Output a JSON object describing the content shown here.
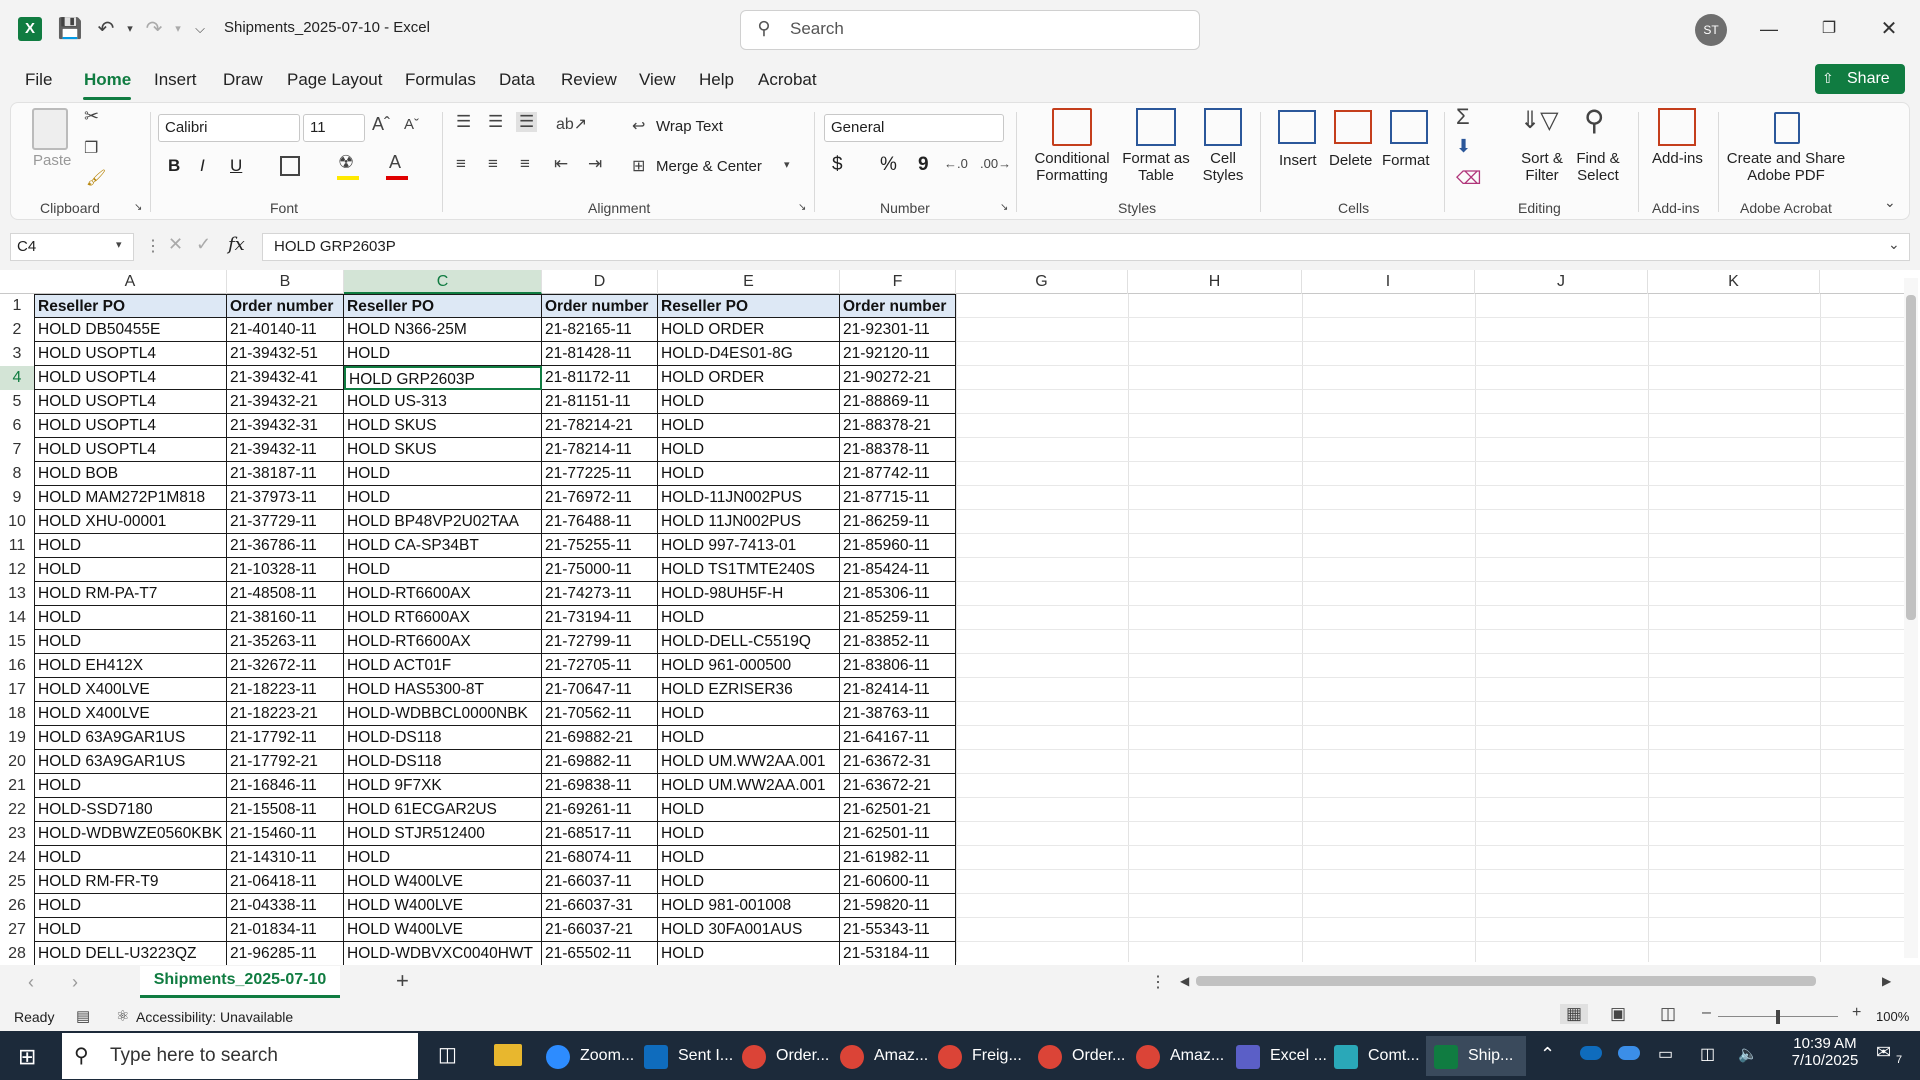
{
  "app": {
    "file_title": "Shipments_2025-07-10",
    "app_name": "Excel",
    "title_sep": "  -  ",
    "search_placeholder": "Search",
    "user_initials": "ST"
  },
  "menu": [
    "File",
    "Home",
    "Insert",
    "Draw",
    "Page Layout",
    "Formulas",
    "Data",
    "Review",
    "View",
    "Help",
    "Acrobat"
  ],
  "share_label": "Share",
  "ribbon": {
    "clipboard": {
      "paste": "Paste",
      "label": "Clipboard"
    },
    "font": {
      "name": "Calibri",
      "size": "11",
      "bold": "B",
      "italic": "I",
      "underline": "U",
      "label": "Font"
    },
    "alignment": {
      "wrap": "Wrap Text",
      "merge": "Merge & Center",
      "label": "Alignment"
    },
    "number": {
      "format": "General",
      "currency": "$",
      "percent": "%",
      "comma": "9",
      "label": "Number"
    },
    "styles": {
      "cond1": "Conditional",
      "cond2": "Formatting",
      "fmt1": "Format as",
      "fmt2": "Table",
      "cell1": "Cell",
      "cell2": "Styles",
      "label": "Styles"
    },
    "cells": {
      "insert": "Insert",
      "delete": "Delete",
      "format": "Format",
      "label": "Cells"
    },
    "editing": {
      "sort1": "Sort &",
      "sort2": "Filter",
      "find1": "Find &",
      "find2": "Select",
      "label": "Editing"
    },
    "addins": {
      "addins": "Add-ins",
      "label": "Add-ins"
    },
    "acrobat": {
      "create1": "Create and Share",
      "create2": "Adobe PDF",
      "label": "Adobe Acrobat"
    }
  },
  "formula_bar": {
    "name_box": "C4",
    "fx": "fx",
    "value": "HOLD GRP2603P"
  },
  "columns": [
    "A",
    "B",
    "C",
    "D",
    "E",
    "F",
    "G",
    "H",
    "I",
    "J",
    "K"
  ],
  "rows": [
    [
      "Reseller PO",
      "Order number",
      "Reseller PO",
      "Order number",
      "Reseller PO",
      "Order number"
    ],
    [
      "HOLD DB50455E",
      "21-40140-11",
      "HOLD N366-25M",
      "21-82165-11",
      "HOLD ORDER",
      "21-92301-11"
    ],
    [
      "HOLD USOPTL4",
      "21-39432-51",
      "HOLD",
      "21-81428-11",
      "HOLD-D4ES01-8G",
      "21-92120-11"
    ],
    [
      "HOLD USOPTL4",
      "21-39432-41",
      "HOLD GRP2603P",
      "21-81172-11",
      "HOLD ORDER",
      "21-90272-21"
    ],
    [
      "HOLD USOPTL4",
      "21-39432-21",
      "HOLD US-313",
      "21-81151-11",
      "HOLD",
      "21-88869-11"
    ],
    [
      "HOLD USOPTL4",
      "21-39432-31",
      "HOLD SKUS",
      "21-78214-21",
      "HOLD",
      "21-88378-21"
    ],
    [
      "HOLD USOPTL4",
      "21-39432-11",
      "HOLD SKUS",
      "21-78214-11",
      "HOLD",
      "21-88378-11"
    ],
    [
      "HOLD BOB",
      "21-38187-11",
      "HOLD",
      "21-77225-11",
      "HOLD",
      "21-87742-11"
    ],
    [
      "HOLD MAM272P1M818",
      "21-37973-11",
      "HOLD",
      "21-76972-11",
      "HOLD-11JN002PUS",
      "21-87715-11"
    ],
    [
      "HOLD XHU-00001",
      "21-37729-11",
      "HOLD BP48VP2U02TAA",
      "21-76488-11",
      "HOLD 11JN002PUS",
      "21-86259-11"
    ],
    [
      "HOLD",
      "21-36786-11",
      "HOLD CA-SP34BT",
      "21-75255-11",
      "HOLD 997-7413-01",
      "21-85960-11"
    ],
    [
      "HOLD",
      "21-10328-11",
      "HOLD",
      "21-75000-11",
      "HOLD TS1TMTE240S",
      "21-85424-11"
    ],
    [
      "HOLD RM-PA-T7",
      "21-48508-11",
      "HOLD-RT6600AX",
      "21-74273-11",
      "HOLD-98UH5F-H",
      "21-85306-11"
    ],
    [
      "HOLD",
      "21-38160-11",
      "HOLD RT6600AX",
      "21-73194-11",
      "HOLD",
      "21-85259-11"
    ],
    [
      "HOLD",
      "21-35263-11",
      "HOLD-RT6600AX",
      "21-72799-11",
      "HOLD-DELL-C5519Q",
      "21-83852-11"
    ],
    [
      "HOLD EH412X",
      "21-32672-11",
      "HOLD ACT01F",
      "21-72705-11",
      "HOLD 961-000500",
      "21-83806-11"
    ],
    [
      "HOLD X400LVE",
      "21-18223-11",
      "HOLD HAS5300-8T",
      "21-70647-11",
      "HOLD EZRISER36",
      "21-82414-11"
    ],
    [
      "HOLD X400LVE",
      "21-18223-21",
      "HOLD-WDBBCL0000NBK",
      "21-70562-11",
      "HOLD",
      "21-38763-11"
    ],
    [
      "HOLD 63A9GAR1US",
      "21-17792-11",
      "HOLD-DS118",
      "21-69882-21",
      "HOLD",
      "21-64167-11"
    ],
    [
      "HOLD 63A9GAR1US",
      "21-17792-21",
      "HOLD-DS118",
      "21-69882-11",
      "HOLD UM.WW2AA.001",
      "21-63672-31"
    ],
    [
      "HOLD",
      "21-16846-11",
      "HOLD 9F7XK",
      "21-69838-11",
      "HOLD UM.WW2AA.001",
      "21-63672-21"
    ],
    [
      "HOLD-SSD7180",
      "21-15508-11",
      "HOLD 61ECGAR2US",
      "21-69261-11",
      "HOLD",
      "21-62501-21"
    ],
    [
      "HOLD-WDBWZE0560KBK",
      "21-15460-11",
      "HOLD STJR512400",
      "21-68517-11",
      "HOLD",
      "21-62501-11"
    ],
    [
      "HOLD",
      "21-14310-11",
      "HOLD",
      "21-68074-11",
      "HOLD",
      "21-61982-11"
    ],
    [
      "HOLD RM-FR-T9",
      "21-06418-11",
      "HOLD W400LVE",
      "21-66037-11",
      "HOLD",
      "21-60600-11"
    ],
    [
      "HOLD",
      "21-04338-11",
      "HOLD W400LVE",
      "21-66037-31",
      "HOLD 981-001008",
      "21-59820-11"
    ],
    [
      "HOLD",
      "21-01834-11",
      "HOLD W400LVE",
      "21-66037-21",
      "HOLD 30FA001AUS",
      "21-55343-11"
    ],
    [
      "HOLD DELL-U3223QZ",
      "21-96285-11",
      "HOLD-WDBVXC0040HWT",
      "21-65502-11",
      "HOLD",
      "21-53184-11"
    ]
  ],
  "sheet_tab": "Shipments_2025-07-10",
  "status": {
    "ready": "Ready",
    "accessibility": "Accessibility: Unavailable",
    "zoom": "100%"
  },
  "taskbar": {
    "search": "Type here to search",
    "apps": [
      "Zoom...",
      "Sent I...",
      "Order...",
      "Amaz...",
      "Freig...",
      "Order...",
      "Amaz...",
      "Excel ...",
      "Comt...",
      "Ship..."
    ],
    "time": "10:39 AM",
    "date": "7/10/2025",
    "notif": "7"
  },
  "colors": {
    "accent": "#107c41",
    "header_fill": "#dde8f5",
    "taskbar": "#1c2a3a"
  }
}
